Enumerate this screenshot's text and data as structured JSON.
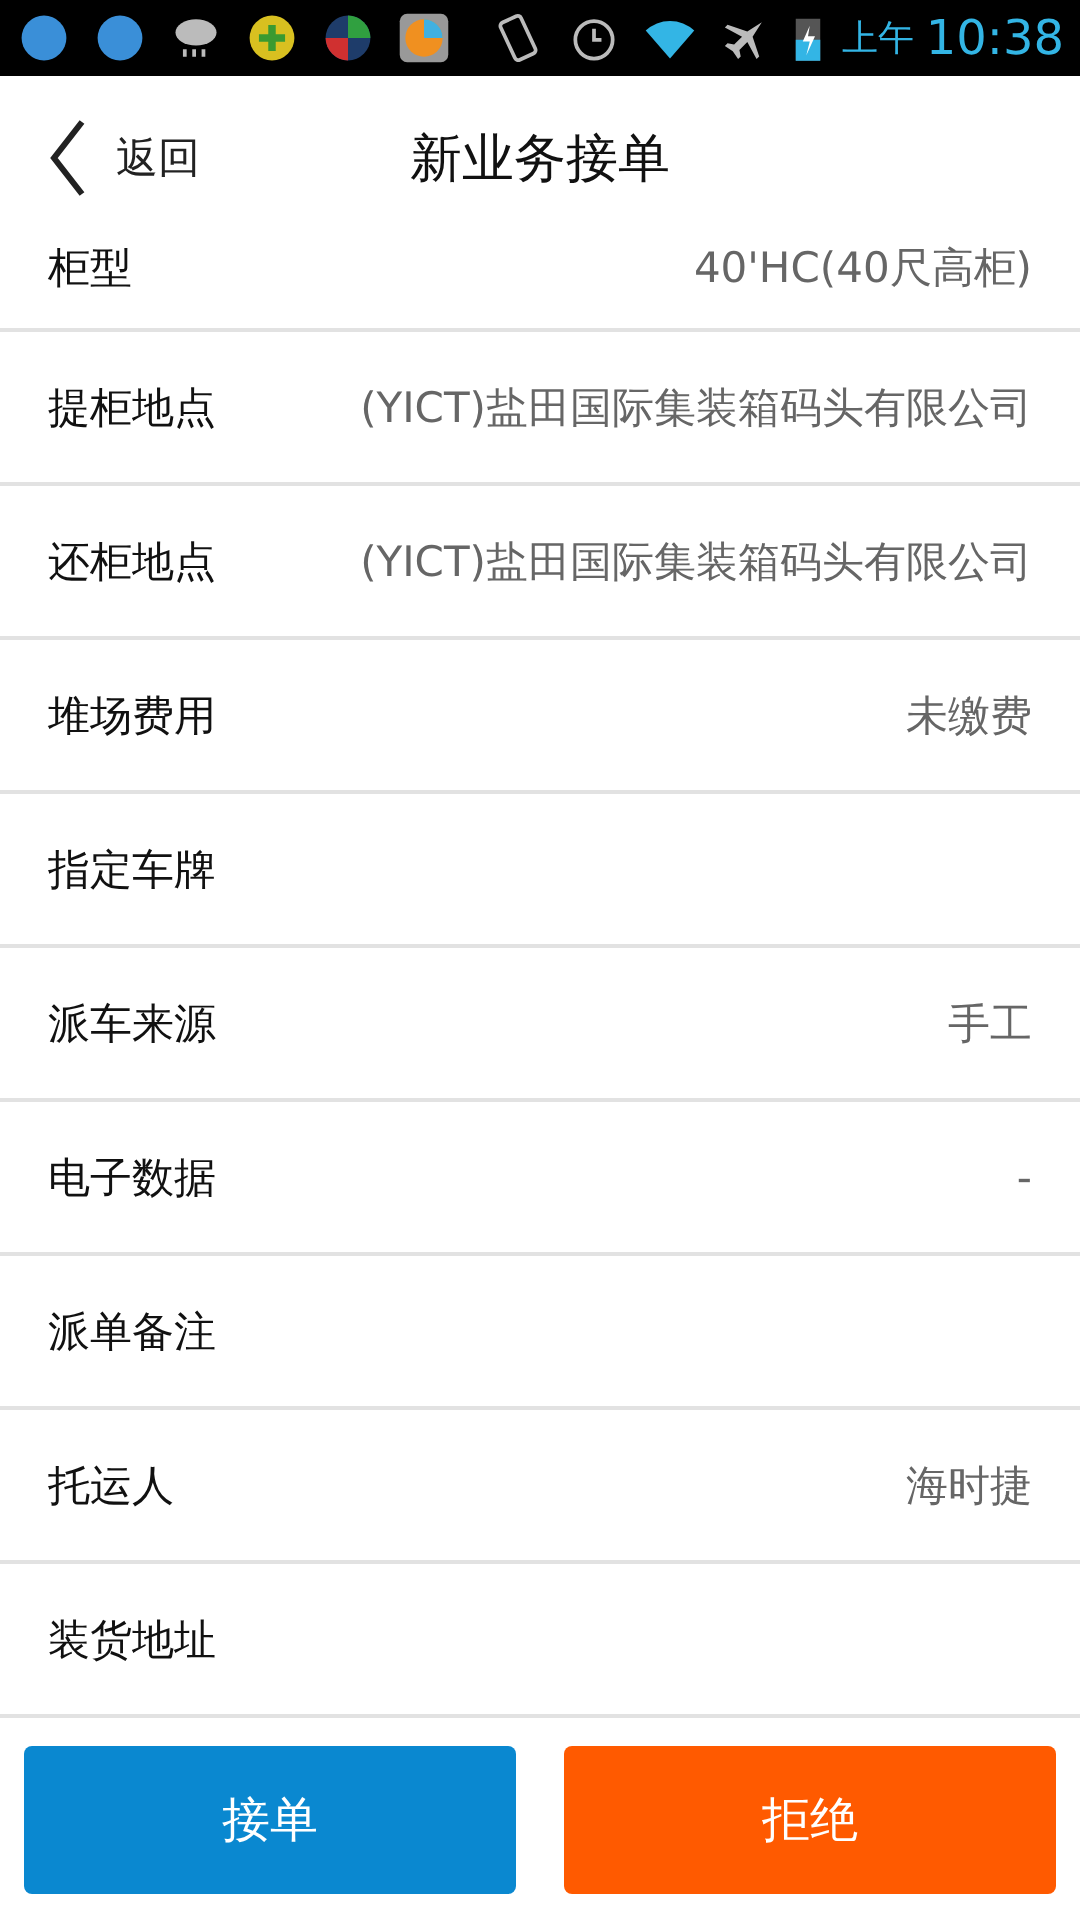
{
  "status_bar": {
    "ampm": "上午",
    "time": "10:38"
  },
  "header": {
    "back_label": "返回",
    "title": "新业务接单"
  },
  "fields": [
    {
      "label": "柜型",
      "value": "40'HC(40尺高柜)"
    },
    {
      "label": "提柜地点",
      "value": "(YICT)盐田国际集装箱码头有限公司"
    },
    {
      "label": "还柜地点",
      "value": "(YICT)盐田国际集装箱码头有限公司"
    },
    {
      "label": "堆场费用",
      "value": "未缴费"
    },
    {
      "label": "指定车牌"
    },
    {
      "label": "派车来源",
      "value": "手工"
    },
    {
      "label": "电子数据",
      "value": "-"
    },
    {
      "label": "派单备注"
    },
    {
      "label": "托运人",
      "value": "海时捷"
    },
    {
      "label": "装货地址"
    }
  ],
  "buttons": [
    {
      "label": "接单",
      "kind": "accept"
    },
    {
      "label": "拒绝",
      "kind": "reject"
    }
  ]
}
